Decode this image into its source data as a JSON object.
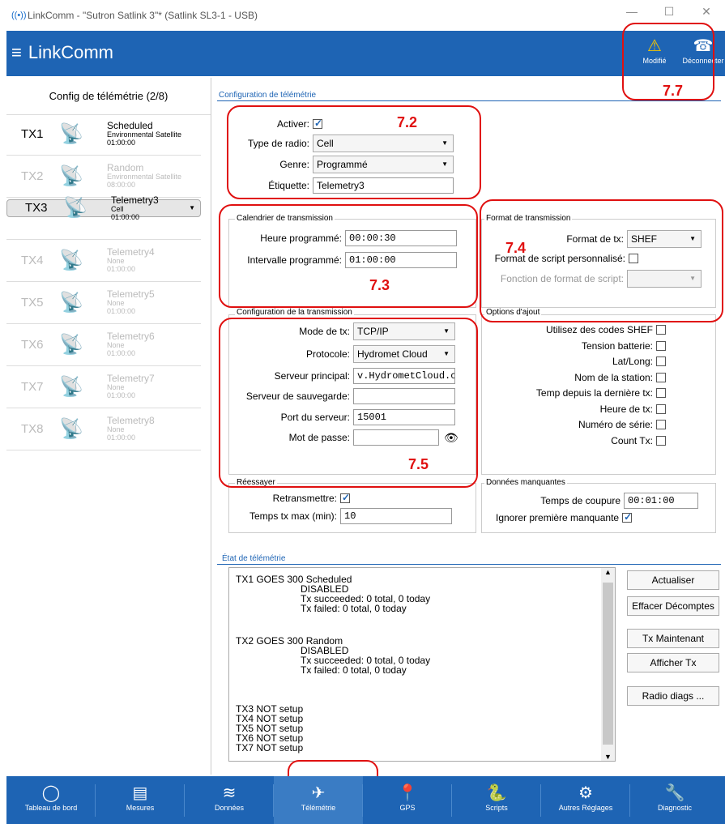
{
  "window": {
    "title": "LinkComm - \"Sutron Satlink 3\"* (Satlink SL3-1 - USB)",
    "min": "—",
    "max": "☐",
    "close": "✕"
  },
  "header": {
    "app": "LinkComm",
    "modified": "Modifié",
    "disconnect": "Déconnecter"
  },
  "sidebar": {
    "title": "Config de télémétrie (2/8)",
    "items": [
      {
        "id": "TX1",
        "name": "Scheduled",
        "sub1": "Environmental Satellite",
        "sub2": "01:00:00"
      },
      {
        "id": "TX2",
        "name": "Random",
        "sub1": "Environmental Satellite",
        "sub2": "08:00:00"
      },
      {
        "id": "TX3",
        "name": "Telemetry3",
        "sub1": "Cell",
        "sub2": "01:00:00"
      },
      {
        "id": "TX4",
        "name": "Telemetry4",
        "sub1": "None",
        "sub2": "01:00:00"
      },
      {
        "id": "TX5",
        "name": "Telemetry5",
        "sub1": "None",
        "sub2": "01:00:00"
      },
      {
        "id": "TX6",
        "name": "Telemetry6",
        "sub1": "None",
        "sub2": "01:00:00"
      },
      {
        "id": "TX7",
        "name": "Telemetry7",
        "sub1": "None",
        "sub2": "01:00:00"
      },
      {
        "id": "TX8",
        "name": "Telemetry8",
        "sub1": "None",
        "sub2": "01:00:00"
      }
    ]
  },
  "config": {
    "section": "Configuration de télémétrie",
    "activer": "Activer:",
    "radio_label": "Type de radio:",
    "radio": "Cell",
    "genre_label": "Genre:",
    "genre": "Programmé",
    "etiquette_label": "Étiquette:",
    "etiquette": "Telemetry3"
  },
  "schedule": {
    "title": "Calendrier de transmission",
    "heure_label": "Heure programmé:",
    "heure": "00:00:30",
    "intervalle_label": "Intervalle programmé:",
    "intervalle": "01:00:00"
  },
  "format": {
    "title": "Format de transmission",
    "fmt_label": "Format de tx:",
    "fmt": "SHEF",
    "custom_label": "Format de script personnalisé:",
    "func_label": "Fonction de format de script:"
  },
  "transmission": {
    "title": "Configuration de la transmission",
    "mode_label": "Mode de tx:",
    "mode": "TCP/IP",
    "proto_label": "Protocole:",
    "proto": "Hydromet Cloud",
    "server_label": "Serveur principal:",
    "server": "v.HydrometCloud.com",
    "backup_label": "Serveur de sauvegarde:",
    "port_label": "Port du serveur:",
    "port": "15001",
    "pass_label": "Mot de passe:"
  },
  "options": {
    "title": "Options d'ajout",
    "items": [
      "Utilisez des codes SHEF",
      "Tension batterie:",
      "Lat/Long:",
      "Nom de la station:",
      "Temp depuis la dernière tx:",
      "Heure de tx:",
      "Numéro de série:",
      "Count Tx:"
    ]
  },
  "retry": {
    "title": "Réessayer",
    "retrans_label": "Retransmettre:",
    "max_label": "Temps tx max (min):",
    "max": "10"
  },
  "missing": {
    "title": "Données manquantes",
    "cut_label": "Temps de coupure",
    "cut": "00:01:00",
    "ignore_label": "Ignorer première manquante"
  },
  "status": {
    "title": "État de télémétrie",
    "lines": [
      "TX1 GOES 300 Scheduled",
      "DISABLED",
      "Tx succeeded: 0 total, 0 today",
      "Tx failed: 0 total, 0 today",
      "TX2 GOES 300 Random",
      "DISABLED",
      "Tx succeeded: 0 total, 0 today",
      "Tx failed: 0 total, 0 today",
      "TX3 NOT setup",
      "TX4 NOT setup",
      "TX5 NOT setup",
      "TX6 NOT setup",
      "TX7 NOT setup"
    ]
  },
  "buttons": {
    "refresh": "Actualiser",
    "clear": "Effacer Décomptes",
    "txnow": "Tx Maintenant",
    "show": "Afficher Tx",
    "diag": "Radio diags ..."
  },
  "annotations": {
    "a72": "7.2",
    "a73": "7.3",
    "a74": "7.4",
    "a75": "7.5",
    "a77": "7.7"
  },
  "nav": [
    "Tableau de bord",
    "Mesures",
    "Données",
    "Télémétrie",
    "GPS",
    "Scripts",
    "Autres Réglages",
    "Diagnostic"
  ]
}
